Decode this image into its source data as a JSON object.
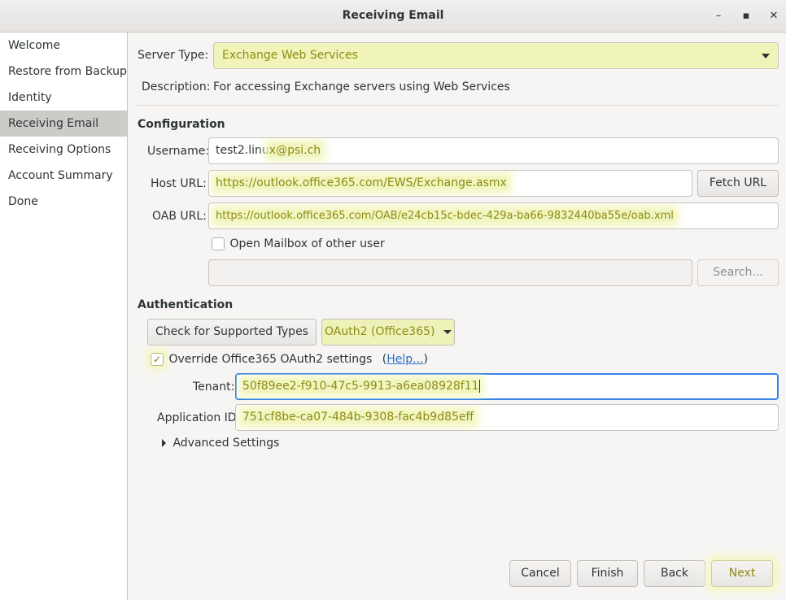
{
  "window": {
    "title": "Receiving Email",
    "minimize_glyph": "–",
    "maximize_glyph": "▪",
    "close_glyph": "✕"
  },
  "sidebar": {
    "items": [
      {
        "label": "Welcome"
      },
      {
        "label": "Restore from Backup"
      },
      {
        "label": "Identity"
      },
      {
        "label": "Receiving Email"
      },
      {
        "label": "Receiving Options"
      },
      {
        "label": "Account Summary"
      },
      {
        "label": "Done"
      }
    ],
    "active_index": 3
  },
  "server": {
    "type_label": "Server Type:",
    "type_value": "Exchange Web Services",
    "description_label": "Description:",
    "description_value": "For accessing Exchange servers using Web Services"
  },
  "configuration": {
    "heading": "Configuration",
    "username_label": "Username:",
    "username_prefix": "test2.linu",
    "username_highlight": "x@psi.ch",
    "host_url_label": "Host URL:",
    "host_url_value": "https://outlook.office365.com/EWS/Exchange.asmx",
    "fetch_url_label": "Fetch URL",
    "oab_url_label": "OAB URL:",
    "oab_url_value": "https://outlook.office365.com/OAB/e24cb15c-bdec-429a-ba66-9832440ba55e/oab.xml",
    "open_mailbox_label": "Open Mailbox of other user",
    "open_mailbox_checked": false,
    "mailbox_value": "",
    "search_label": "Search..."
  },
  "authentication": {
    "heading": "Authentication",
    "check_types_label": "Check for Supported Types",
    "method_value": "OAuth2 (Office365)",
    "override_label": "Override Office365 OAuth2 settings",
    "override_checked": true,
    "help_open": "(",
    "help_label": "Help...",
    "help_close": ")",
    "tenant_label": "Tenant:",
    "tenant_value": "50f89ee2-f910-47c5-9913-a6ea08928f11",
    "app_id_label": "Application ID:",
    "app_id_value": "751cf8be-ca07-484b-9308-fac4b9d85eff",
    "advanced_label": "Advanced Settings"
  },
  "footer": {
    "cancel_label": "Cancel",
    "finish_label": "Finish",
    "back_label": "Back",
    "next_label": "Next"
  },
  "colors": {
    "highlight": "#f5f7c0",
    "highlight_text": "#8a8a13",
    "focus": "#3584e4",
    "sidebar_active": "#cdcbc8"
  }
}
